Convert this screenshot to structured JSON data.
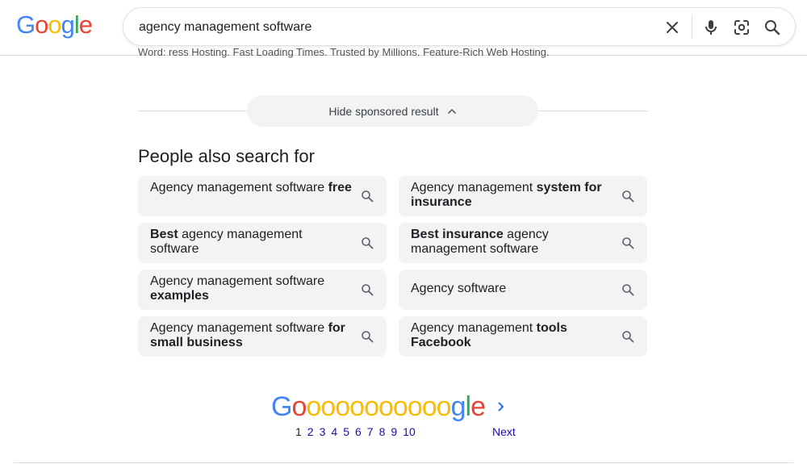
{
  "logo": {
    "letters": [
      "G",
      "o",
      "o",
      "g",
      "l",
      "e"
    ],
    "colors": [
      "#4285F4",
      "#EA4335",
      "#FBBC05",
      "#4285F4",
      "#34A853",
      "#EA4335"
    ]
  },
  "search": {
    "value": "agency management software",
    "icons": [
      "close-icon",
      "mic-icon",
      "lens-icon",
      "search-icon"
    ]
  },
  "ad_snippet": "Word: ress Hosting. Fast Loading Times. Trusted by Millions. Feature-Rich Web Hosting.",
  "sponsored": {
    "hide_label": "Hide sponsored result"
  },
  "pasf": {
    "title": "People also search for",
    "items": [
      {
        "pre": "Agency management software ",
        "bold": "free",
        "post": ""
      },
      {
        "pre": "Agency management ",
        "bold": "system for insurance",
        "post": ""
      },
      {
        "pre": "",
        "bold": "Best",
        "post": " agency management software"
      },
      {
        "pre": "",
        "bold": "Best insurance",
        "post": " agency management software"
      },
      {
        "pre": "Agency management software ",
        "bold": "examples",
        "post": ""
      },
      {
        "pre": "Agency software",
        "bold": "",
        "post": ""
      },
      {
        "pre": "Agency management software ",
        "bold": "for small business",
        "post": ""
      },
      {
        "pre": "Agency management ",
        "bold": "tools Facebook",
        "post": ""
      }
    ]
  },
  "pagination": {
    "logo_letters": [
      "G",
      "o",
      "o",
      "o",
      "o",
      "o",
      "o",
      "o",
      "o",
      "o",
      "o",
      "o",
      "g",
      "l",
      "e"
    ],
    "logo_colors": [
      "#4285F4",
      "#EA4335",
      "#FBBC05",
      "#FBBC05",
      "#FBBC05",
      "#FBBC05",
      "#FBBC05",
      "#FBBC05",
      "#FBBC05",
      "#FBBC05",
      "#FBBC05",
      "#FBBC05",
      "#4285F4",
      "#34A853",
      "#EA4335"
    ],
    "current": "1",
    "pages": [
      "2",
      "3",
      "4",
      "5",
      "6",
      "7",
      "8",
      "9",
      "10"
    ],
    "next_label": "Next"
  },
  "colors": {
    "link": "#1a0dab",
    "chip_bg": "#f1f3f4",
    "divider": "#dadce0",
    "icon": "#5f6368"
  }
}
